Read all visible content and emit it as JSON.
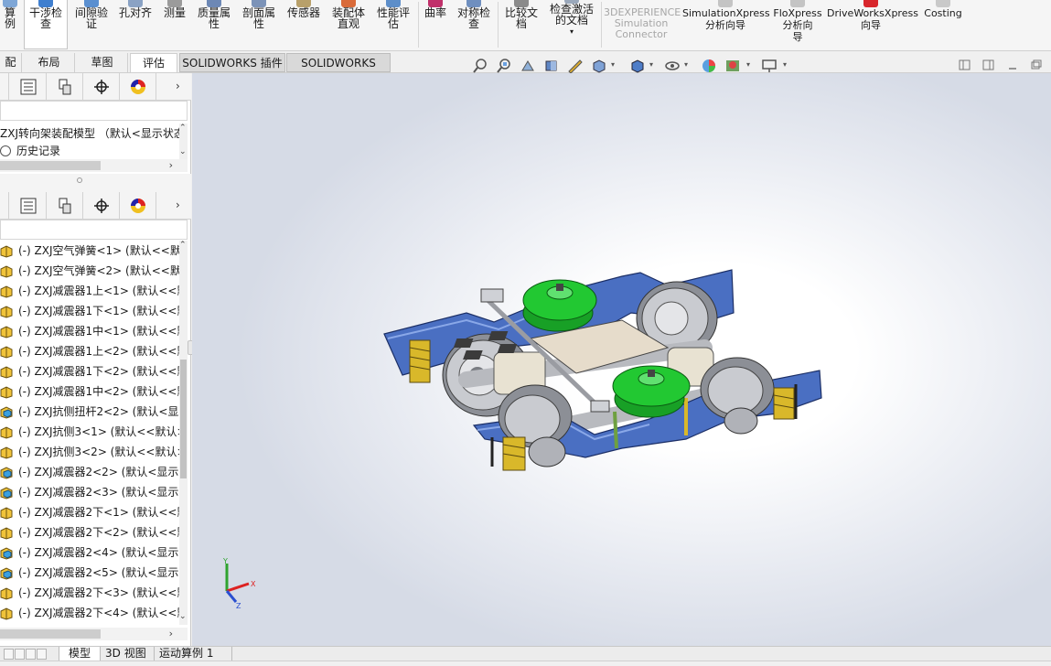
{
  "ribbon": {
    "items": [
      {
        "label": "算\n例",
        "icon": "calc-icon"
      },
      {
        "label": "干涉检\n查",
        "icon": "interference-icon",
        "active": true
      },
      {
        "label": "间隙验\n证",
        "icon": "clearance-icon"
      },
      {
        "label": "孔对齐",
        "icon": "hole-align-icon"
      },
      {
        "label": "测量",
        "icon": "measure-icon"
      },
      {
        "label": "质量属\n性",
        "icon": "mass-props-icon"
      },
      {
        "label": "剖面属\n性",
        "icon": "section-props-icon"
      },
      {
        "label": "传感器",
        "icon": "sensor-icon"
      },
      {
        "label": "装配体\n直观",
        "icon": "assembly-visual-icon"
      },
      {
        "label": "性能评\n估",
        "icon": "performance-icon"
      },
      {
        "label": "曲率",
        "icon": "curvature-icon"
      },
      {
        "label": "对称检\n查",
        "icon": "symmetry-icon"
      },
      {
        "label": "比较文\n档",
        "icon": "compare-icon"
      },
      {
        "label": "检查激活\n的文档",
        "icon": "check-doc-icon",
        "dropdown": "▾"
      },
      {
        "label": "3DEXPERIENCE\nSimulation\nConnector",
        "icon": "3dx-icon",
        "disabled": true
      },
      {
        "label": "SimulationXpress\n分析向导",
        "icon": "simxpress-icon"
      },
      {
        "label": "FloXpress\n分析向\n导",
        "icon": "floxpress-icon"
      },
      {
        "label": "DriveWorksXpress\n向导",
        "icon": "driveworks-icon"
      },
      {
        "label": "Costing",
        "icon": "costing-icon"
      }
    ]
  },
  "command_tabs": [
    "配体",
    "布局",
    "草图",
    "评估",
    "SOLIDWORKS 插件",
    "SOLIDWORKS MBD"
  ],
  "active_tab": "评估",
  "feature_tree": {
    "root_label": "ZXJ转向架装配模型 （默认<显示状态",
    "history_label": "历史记录"
  },
  "component_list": {
    "rows": [
      {
        "label": "(-) ZXJ空气弹簧<1> (默认<<默",
        "icon": "part-icon"
      },
      {
        "label": "(-) ZXJ空气弹簧<2> (默认<<默",
        "icon": "part-icon"
      },
      {
        "label": "(-) ZXJ减震器1上<1> (默认<<默",
        "icon": "part-icon"
      },
      {
        "label": "(-) ZXJ减震器1下<1> (默认<<默",
        "icon": "part-icon"
      },
      {
        "label": "(-) ZXJ减震器1中<1> (默认<<默",
        "icon": "part-icon"
      },
      {
        "label": "(-) ZXJ减震器1上<2> (默认<<默",
        "icon": "part-icon"
      },
      {
        "label": "(-) ZXJ减震器1下<2> (默认<<默",
        "icon": "part-icon"
      },
      {
        "label": "(-) ZXJ减震器1中<2> (默认<<默",
        "icon": "part-icon"
      },
      {
        "label": "(-) ZXJ抗侧扭杆2<2> (默认<显示",
        "icon": "assembly-icon"
      },
      {
        "label": "(-) ZXJ抗侧3<1> (默认<<默认>",
        "icon": "part-icon"
      },
      {
        "label": "(-) ZXJ抗侧3<2> (默认<<默认>",
        "icon": "part-icon"
      },
      {
        "label": "(-) ZXJ减震器2<2> (默认<显示",
        "icon": "assembly-icon"
      },
      {
        "label": "(-) ZXJ减震器2<3> (默认<显示",
        "icon": "assembly-icon"
      },
      {
        "label": "(-) ZXJ减震器2下<1> (默认<<默",
        "icon": "part-icon"
      },
      {
        "label": "(-) ZXJ减震器2下<2> (默认<<默",
        "icon": "part-icon"
      },
      {
        "label": "(-) ZXJ减震器2<4> (默认<显示",
        "icon": "assembly-icon"
      },
      {
        "label": "(-) ZXJ减震器2<5> (默认<显示",
        "icon": "assembly-icon"
      },
      {
        "label": "(-) ZXJ减震器2下<3> (默认<<默",
        "icon": "part-icon"
      },
      {
        "label": "(-) ZXJ减震器2下<4> (默认<<默",
        "icon": "part-icon"
      }
    ]
  },
  "bottom_tabs": [
    "模型",
    "3D 视图",
    "运动算例 1"
  ],
  "active_bottom_tab": "模型",
  "triad": {
    "x": "X",
    "y": "Y",
    "z": "Z"
  },
  "colors": {
    "frame_blue": "#4a6fc2",
    "air_spring_green": "#22c832",
    "spring_yellow": "#d9b82a",
    "wheel_gray": "#b0b2b8",
    "plate_tan": "#e6dccb"
  }
}
